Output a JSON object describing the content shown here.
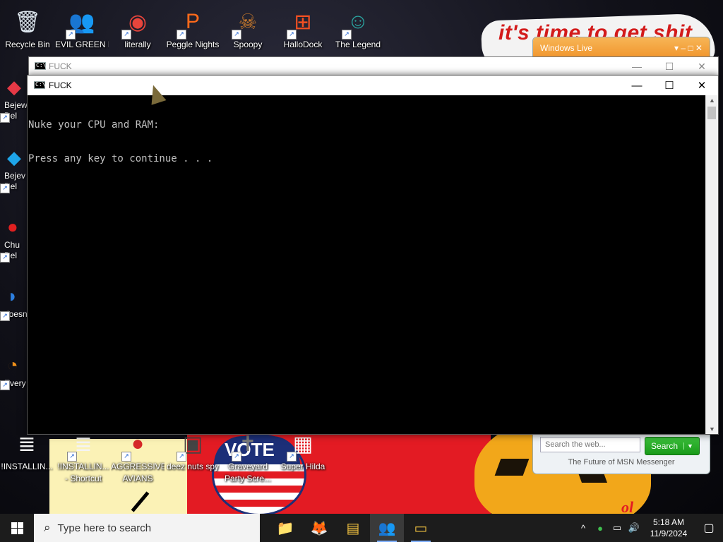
{
  "wallpaper": {
    "slogan": "it's time to get shit",
    "vote_text": "VOTE",
    "halloween_text": "ol"
  },
  "desktop_icons_top": [
    {
      "label": "Recycle Bin",
      "icon": "recycle-bin-icon",
      "glyph": "🗑",
      "color": "#dfe8f0",
      "shortcut": false
    },
    {
      "label": "EVIL GREEN MEN CO",
      "icon": "msn-buddies-icon",
      "glyph": "👥",
      "color": "#31a64a",
      "shortcut": true
    },
    {
      "label": "literally",
      "icon": "chrome-icon",
      "glyph": "◉",
      "color": "#e8453c",
      "shortcut": true
    },
    {
      "label": "Peggle Nights",
      "icon": "peggle-icon",
      "glyph": "P",
      "color": "#ff6a1a",
      "shortcut": true
    },
    {
      "label": "Spoopy",
      "icon": "spoopy-icon",
      "glyph": "☠",
      "color": "#c97a2c",
      "shortcut": true
    },
    {
      "label": "HalloDock",
      "icon": "hallodock-icon",
      "glyph": "⊞",
      "color": "#f25022",
      "shortcut": true
    },
    {
      "label": "The Legend",
      "icon": "legend-icon",
      "glyph": "☺",
      "color": "#2aa5a0",
      "shortcut": true
    }
  ],
  "desktop_icons_left": [
    {
      "label": "Bejew",
      "label2": "Del",
      "icon": "bejeweled-icon",
      "glyph": "◆",
      "color": "#e63946"
    },
    {
      "label": "Bejev",
      "label2": "Del",
      "icon": "bejeweled-diamond-icon",
      "glyph": "◆",
      "color": "#1ea5e9"
    },
    {
      "label": "Chu",
      "label2": "Del",
      "icon": "chuzzle-icon",
      "glyph": "●",
      "color": "#e02020"
    },
    {
      "label": "doesn",
      "label2": "",
      "icon": "blue-app-icon",
      "glyph": "◗",
      "color": "#2d7fe0"
    },
    {
      "label": "Every",
      "label2": "",
      "icon": "orange-app-icon",
      "glyph": "◔",
      "color": "#f0901a"
    }
  ],
  "desktop_icons_bottom": [
    {
      "label": "!INSTALLIN...",
      "label2": "",
      "icon": "text-file-icon",
      "glyph": "≣",
      "color": "#f4f4f4",
      "shortcut": false
    },
    {
      "label": "!INSTALLIN...",
      "label2": "- Shortcut",
      "icon": "text-file-shortcut-icon",
      "glyph": "≣",
      "color": "#f4f4f4",
      "shortcut": true
    },
    {
      "label": "AGGRESSIVE",
      "label2": "AVIANS",
      "icon": "angry-bird-icon",
      "glyph": "●",
      "color": "#d62828",
      "shortcut": true
    },
    {
      "label": "deez nuts spy",
      "label2": "",
      "icon": "spy-icon",
      "glyph": "▣",
      "color": "#444444",
      "shortcut": true
    },
    {
      "label": "Graveyard",
      "label2": "Party Scre...",
      "icon": "graveyard-icon",
      "glyph": "✝",
      "color": "#7a7a7a",
      "shortcut": true
    },
    {
      "label": "Super Hilda",
      "label2": "",
      "icon": "super-hilda-icon",
      "glyph": "▦",
      "color": "#ffffff",
      "shortcut": true
    }
  ],
  "msn_widget": {
    "title": "Windows Live",
    "search_placeholder": "Search the web...",
    "search_button": "Search",
    "footer": "The Future of MSN Messenger"
  },
  "background_window": {
    "title": "FUCK"
  },
  "console_window": {
    "title": "FUCK",
    "lines": [
      "Nuke your CPU and RAM:",
      "Press any key to continue . . ."
    ]
  },
  "taskbar": {
    "search_placeholder": "Type here to search",
    "apps": [
      {
        "icon": "file-explorer-icon",
        "glyph": "📁",
        "active": false,
        "running": false
      },
      {
        "icon": "firefox-icon",
        "glyph": "🦊",
        "active": false,
        "running": false
      },
      {
        "icon": "notepad-app-icon",
        "glyph": "▤",
        "active": false,
        "running": false
      },
      {
        "icon": "msn-messenger-icon",
        "glyph": "👥",
        "active": true,
        "running": true
      },
      {
        "icon": "command-prompt-icon",
        "glyph": "▭",
        "active": false,
        "running": true
      }
    ],
    "time": "5:18 AM",
    "date": "11/9/2024"
  },
  "colors": {
    "taskbar_bg": "#1c1c1c",
    "console_bg": "#000000",
    "console_text": "#c0c0c0"
  }
}
